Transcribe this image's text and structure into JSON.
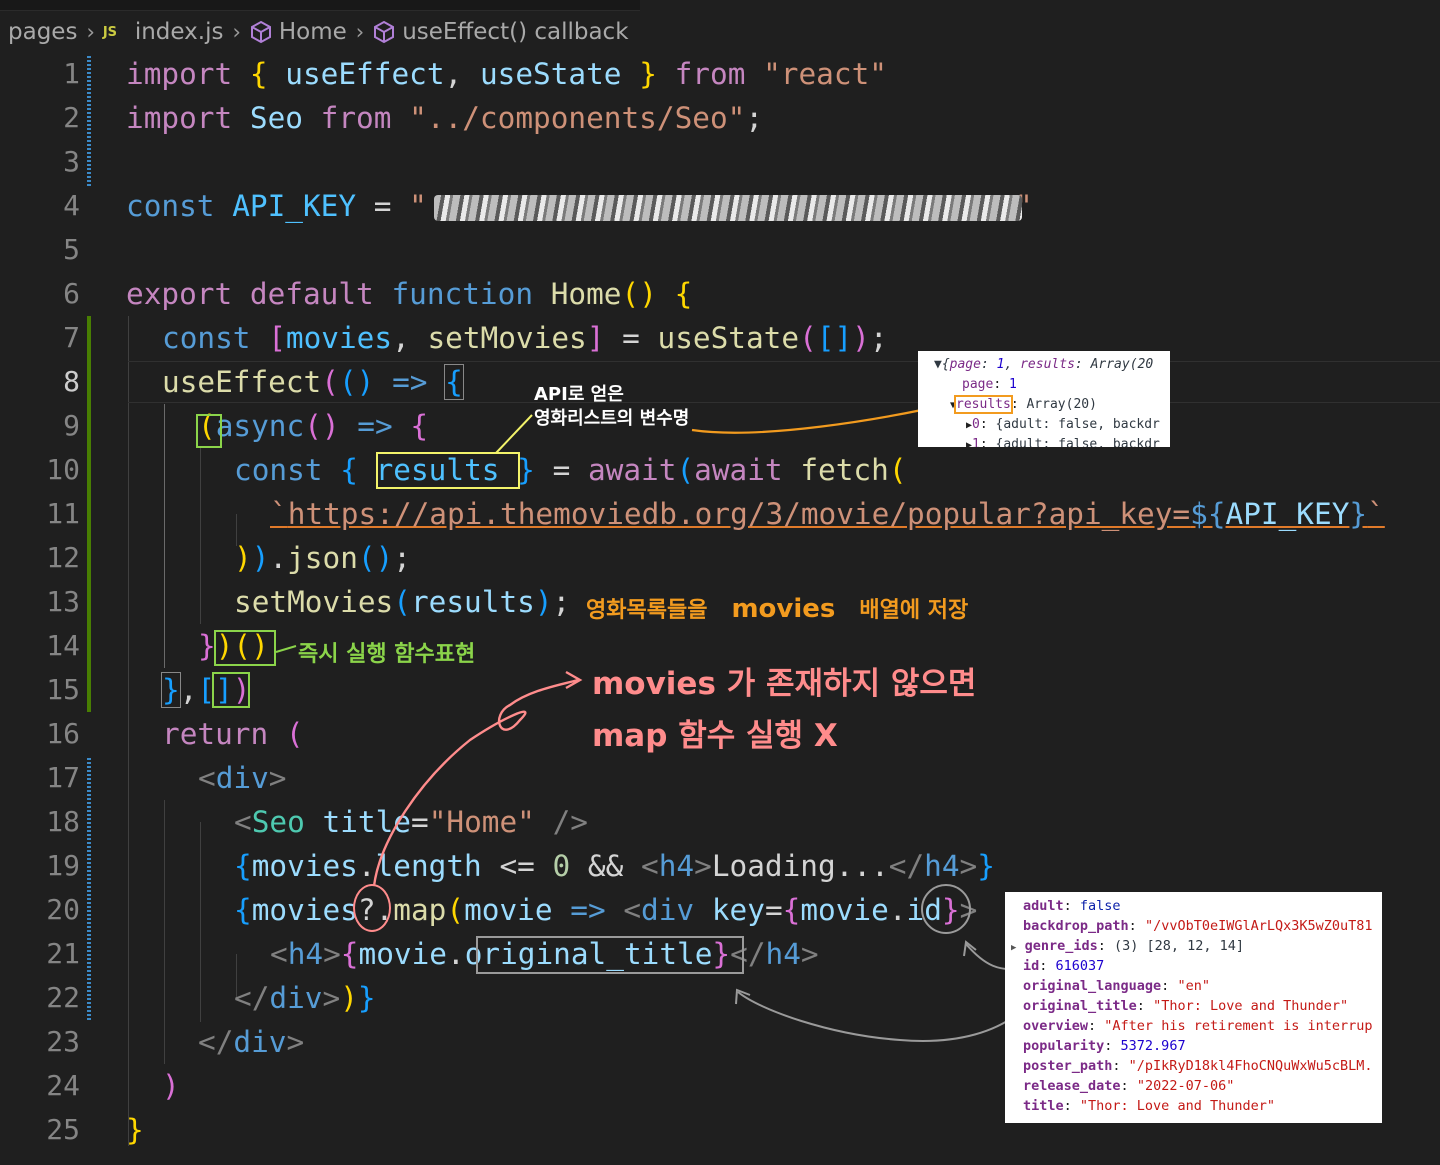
{
  "breadcrumb": {
    "folder": "pages",
    "file_icon": "JS",
    "file": "index.js",
    "symbol1": "Home",
    "symbol2": "useEffect() callback"
  },
  "gutter": [
    "1",
    "2",
    "3",
    "4",
    "5",
    "6",
    "7",
    "8",
    "9",
    "10",
    "11",
    "12",
    "13",
    "14",
    "15",
    "16",
    "17",
    "18",
    "19",
    "20",
    "21",
    "22",
    "23",
    "24",
    "25"
  ],
  "code": {
    "l1_import": "import",
    "l1_useEffect": "useEffect",
    "l1_useState": "useState",
    "l1_from": "from",
    "l1_str": "\"react\"",
    "l2_import": "import",
    "l2_seo": "Seo",
    "l2_from": "from",
    "l2_str": "\"../components/Seo\"",
    "l4_const": "const",
    "l4_api": "API_KEY",
    "l6_export": "export",
    "l6_default": "default",
    "l6_function": "function",
    "l6_home": "Home",
    "l7_const": "const",
    "l7_movies": "movies",
    "l7_set": "setMovies",
    "l7_usestate": "useState",
    "l8_useeffect": "useEffect",
    "l9_async": "async",
    "l10_const": "const",
    "l10_results": "results",
    "l10_await1": "await",
    "l10_await2": "await",
    "l10_fetch": "fetch",
    "l11_url": "https://api.themoviedb.org/3/movie/popular?api_key=",
    "l11_api": "API_KEY",
    "l12_json": "json",
    "l13_set": "setMovies",
    "l13_results": "results",
    "l16_return": "return",
    "l17_div": "div",
    "l18_seo": "Seo",
    "l18_title": "title",
    "l18_val": "\"Home\"",
    "l19_movies": "movies",
    "l19_length": "length",
    "l19_zero": "0",
    "l19_h4": "h4",
    "l19_text": "Loading...",
    "l19_h4c": "h4",
    "l20_movies": "movies",
    "l20_map": "map",
    "l20_movie": "movie",
    "l20_div": "div",
    "l20_key": "key",
    "l20_movie2": "movie",
    "l20_id": "id",
    "l21_h4": "h4",
    "l21_movie": "movie",
    "l21_title": "original_title",
    "l21_h4c": "h4",
    "l22_div": "div",
    "l23_div": "div"
  },
  "annotations": {
    "results_note_line1": "API로 얻은",
    "results_note_line2": "영화리스트의 변수명",
    "set_note_a": "영화목록들을",
    "set_note_b": "movies",
    "set_note_c": "배열에 저장",
    "iife_note": "즉시 실행 함수표현",
    "map_note_line1": "movies 가 존재하지 않으면",
    "map_note_line2": "map 함수 실행 X",
    "colors": {
      "orange": "#f29b1f",
      "green": "#8bd44a",
      "pink": "#ff8c8c",
      "gray": "#9a9a9a",
      "yellow": "#f3f36a"
    }
  },
  "console_top": {
    "r1_prefix": "{",
    "r1_k1": "page",
    "r1_v1": "1",
    "r1_k2": "results",
    "r1_v2": "Array(20",
    "r2_k": "page",
    "r2_v": "1",
    "r3_k": "results",
    "r3_v": "Array(20)",
    "r4_k": "0",
    "r4_v": "{adult: false, backdr",
    "r5_k": "1",
    "r5_v": "{adult: false, backdr"
  },
  "console_obj": [
    {
      "key": "adult",
      "value": "false",
      "type": "kw"
    },
    {
      "key": "backdrop_path",
      "value": "\"/vvObT0eIWGlArLQx3K5wZ0uT81",
      "type": "str"
    },
    {
      "key": "genre_ids",
      "value": "(3) [28, 12, 14]",
      "type": "plain",
      "expand": "▶"
    },
    {
      "key": "id",
      "value": "616037",
      "type": "num"
    },
    {
      "key": "original_language",
      "value": "\"en\"",
      "type": "str"
    },
    {
      "key": "original_title",
      "value": "\"Thor: Love and Thunder\"",
      "type": "str"
    },
    {
      "key": "overview",
      "value": "\"After his retirement is interrup",
      "type": "str"
    },
    {
      "key": "popularity",
      "value": "5372.967",
      "type": "num"
    },
    {
      "key": "poster_path",
      "value": "\"/pIkRyD18kl4FhoCNQuWxWu5cBLM.",
      "type": "str"
    },
    {
      "key": "release_date",
      "value": "\"2022-07-06\"",
      "type": "str"
    },
    {
      "key": "title",
      "value": "\"Thor: Love and Thunder\"",
      "type": "str"
    }
  ]
}
